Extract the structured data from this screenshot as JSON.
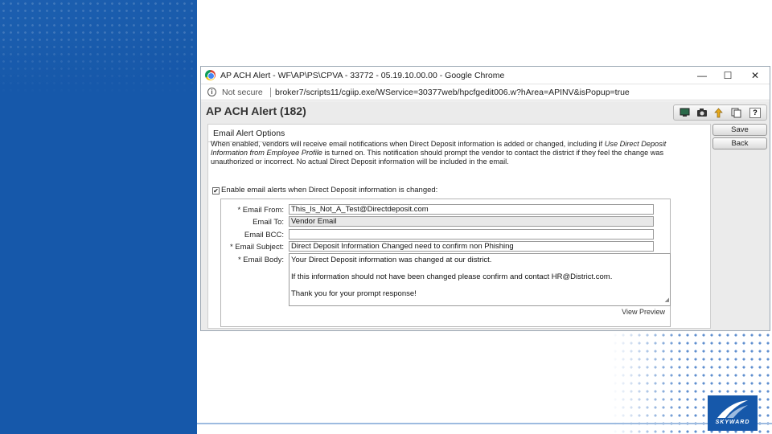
{
  "window": {
    "title": "AP ACH Alert - WF\\AP\\PS\\CPVA - 33772 - 05.19.10.00.00 - Google Chrome",
    "minimize": "—",
    "maximize": "☐",
    "close": "✕"
  },
  "address_bar": {
    "security": "Not secure",
    "url": "broker7/scripts11/cgiip.exe/WService=30377web/hpcfgedit006.w?hArea=APINV&isPopup=true"
  },
  "page": {
    "title": "AP ACH Alert (182)",
    "section_title": "Email Alert Options",
    "desc_part1": "When enabled, vendors will receive email notifications when Direct Deposit information is added or changed, including if ",
    "desc_italic": "Use Direct Deposit Information from Employee Profile",
    "desc_part2": " is turned on. This notification should prompt the vendor to contact the district if they feel the change was unauthorized or incorrect. No actual Direct Deposit information will be included in the email.",
    "enable_label": "Enable email alerts when Direct Deposit information is changed:",
    "enable_checked": "✔",
    "fields": {
      "email_from_label": "* Email From:",
      "email_from_value": "This_Is_Not_A_Test@Directdeposit.com",
      "email_to_label": "Email To:",
      "email_to_value": "Vendor Email",
      "email_bcc_label": "Email BCC:",
      "email_bcc_value": "",
      "email_subject_label": "* Email Subject:",
      "email_subject_value": "Direct Deposit Information Changed need to confirm non Phishing",
      "email_body_label": "* Email Body:",
      "email_body_line1": "Your Direct Deposit information was changed at our district.",
      "email_body_line2": "If this information should not have been changed please confirm and contact HR@District.com.",
      "email_body_line3": "Thank you for your prompt response!"
    },
    "view_preview": "View Preview",
    "buttons": {
      "save": "Save",
      "back": "Back"
    },
    "toolbar_icons": [
      "monitor-icon",
      "camera-icon",
      "upload-icon",
      "copy-icon",
      "help-icon"
    ],
    "toolbar_help": "?"
  },
  "logo": {
    "text": "SKYWARD"
  },
  "colors": {
    "brand_blue": "#1658aa",
    "accent_light": "#9dbbe0"
  }
}
